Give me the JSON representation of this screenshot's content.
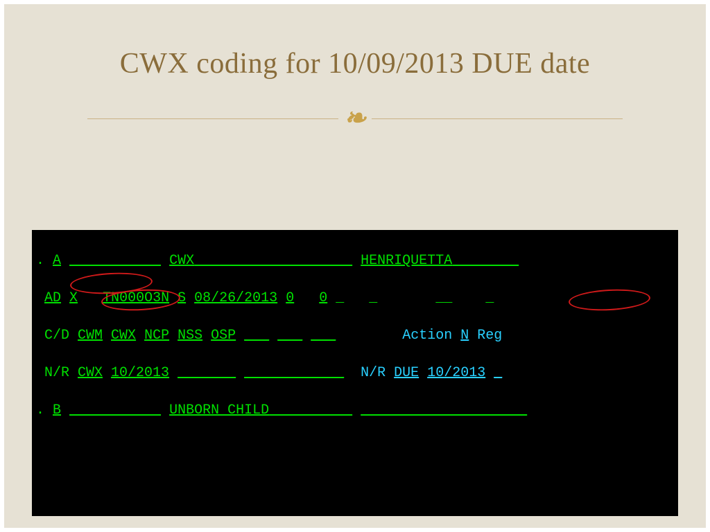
{
  "title": "CWX coding for 10/09/2013 DUE date",
  "ornament_glyph": "❧",
  "terminal": {
    "l1": {
      "a": ". ",
      "b": "A",
      "c": " ",
      "d": "           ",
      "e": " ",
      "f": "CWX",
      "g": "                   ",
      "h": " ",
      "i": "HENRIQUETTA",
      "j": "        "
    },
    "l2": {
      "a": " ",
      "b": "AD",
      "c": " ",
      "d": "X",
      "e": "   ",
      "f": "TN000O3N",
      "g": " ",
      "h": "S",
      "i": " ",
      "j": "08/26/2013",
      "k": " ",
      "l": "0",
      "m": "   ",
      "n": "0",
      "o": " ",
      "p": "_",
      "q": "   ",
      "r": "_",
      "s": "       ",
      "t": "__",
      "u": "    ",
      "v": "_"
    },
    "l3": {
      "a": " C/D ",
      "b": "CWM",
      "c": " ",
      "d": "CWX",
      "e": " ",
      "f": "NCP",
      "g": " ",
      "h": "NSS",
      "i": " ",
      "j": "OSP",
      "k": " ",
      "l": "___",
      "m": " ",
      "n": "___",
      "o": " ",
      "p": "___",
      "q": "        Action ",
      "r": "N",
      "s": " Reg"
    },
    "l4": {
      "a": " N/R ",
      "b": "CWX",
      "c": " ",
      "d": "10/2013",
      "e": " ",
      "f": "_______",
      "g": " ",
      "h": "____________",
      "i": "  N/R ",
      "j": "DUE",
      "k": " ",
      "l": "10/2013",
      "m": " ",
      "n": "_"
    },
    "l5": {
      "a": ". ",
      "b": "B",
      "c": " ",
      "d": "           ",
      "e": " ",
      "f": "UNBORN CHILD",
      "g": "          ",
      "h": " ",
      "i": "                    "
    }
  }
}
